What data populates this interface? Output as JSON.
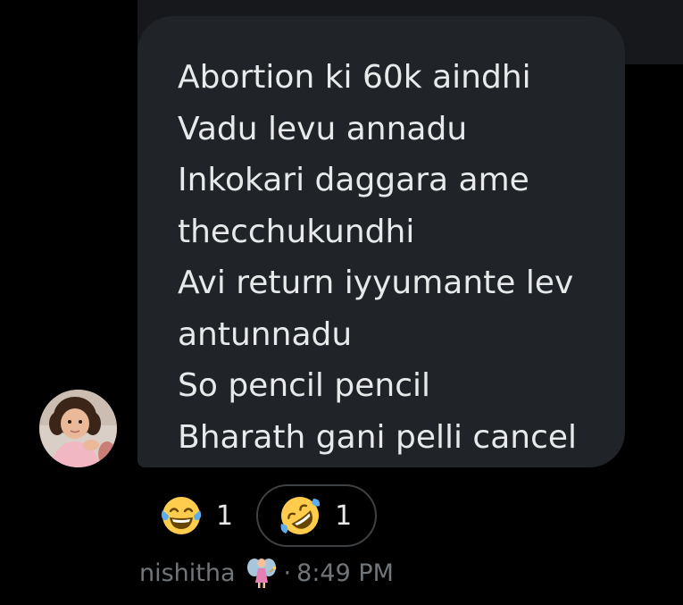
{
  "message": {
    "lines": [
      "Abortion ki 60k aindhi",
      "Vadu levu annadu",
      "Inkokari daggara ame",
      "thecchukundhi",
      "Avi return iyyumante lev",
      "antunnadu",
      "So pencil pencil",
      "Bharath gani pelli cancel"
    ]
  },
  "reactions": [
    {
      "icon": "face-with-tears-of-joy-icon",
      "count": "1"
    },
    {
      "icon": "rolling-on-floor-laughing-icon",
      "count": "1"
    }
  ],
  "meta": {
    "sender": "nishitha",
    "separator": "·",
    "time": "8:49 PM",
    "sender_icon": "fairy-icon"
  },
  "colors": {
    "background": "#000000",
    "bubble": "#202327",
    "text": "#e7e9ea",
    "muted": "#71767b",
    "reaction_border": "#3e4144"
  }
}
